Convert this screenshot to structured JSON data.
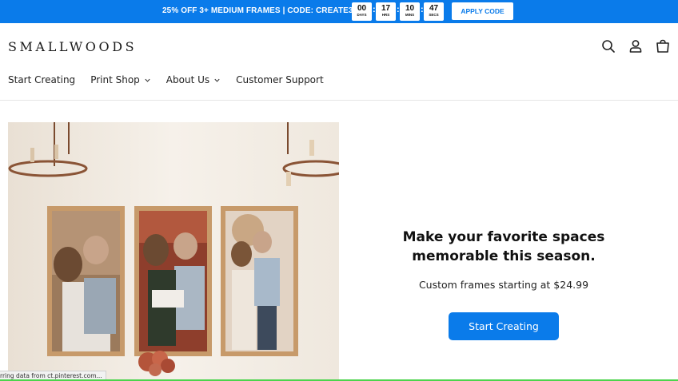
{
  "promo": {
    "text": "25% OFF 3+ MEDIUM FRAMES | CODE: CREATE3",
    "countdown": [
      {
        "value": "00",
        "unit": "DAYS"
      },
      {
        "value": "17",
        "unit": "HRS"
      },
      {
        "value": "10",
        "unit": "MINS"
      },
      {
        "value": "47",
        "unit": "SECS"
      }
    ],
    "apply_label": "APPLY CODE"
  },
  "header": {
    "logo": "SMALLWOODS",
    "icons": [
      "search-icon",
      "account-icon",
      "cart-icon"
    ]
  },
  "nav": {
    "items": [
      {
        "label": "Start Creating"
      },
      {
        "label": "Print Shop"
      },
      {
        "label": "About Us"
      },
      {
        "label": "Customer Support"
      }
    ]
  },
  "hero": {
    "headline_line1": "Make your favorite spaces",
    "headline_line2": "memorable this season.",
    "subline": "Custom frames starting at $24.99",
    "cta_label": "Start Creating"
  },
  "status_bar": {
    "text": "rring data from ct.pinterest.com..."
  },
  "colors": {
    "accent": "#0a7bea",
    "load_bar": "#4cd44c"
  }
}
